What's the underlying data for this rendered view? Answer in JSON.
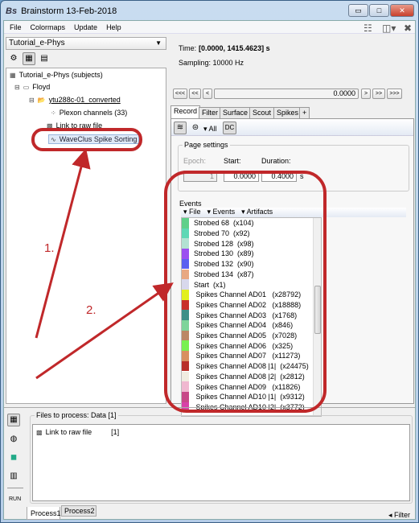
{
  "window": {
    "title": "Brainstorm 13-Feb-2018",
    "min": "▭",
    "max": "□",
    "close": "✕"
  },
  "menu": [
    "File",
    "Colormaps",
    "Update",
    "Help"
  ],
  "toolbar_right": {
    "list_icon": "☷",
    "layout_icon": "◫▾",
    "close_icon": "✖"
  },
  "left": {
    "protocol": "Tutorial_e-Phys",
    "tree": {
      "root": "Tutorial_e-Phys (subjects)",
      "subject": "Floyd",
      "condition": "ytu288c-01_converted",
      "channels": "Plexon channels (33)",
      "link": "Link to raw file",
      "selected": "WaveClus Spike Sorting"
    }
  },
  "right": {
    "time_label": "Time:",
    "time_value": "[0.0000, 1415.4623] s",
    "sampling": "Sampling: 10000 Hz",
    "nav": [
      "<<<",
      "<<",
      "<",
      "0.0000",
      ">",
      ">>",
      ">>>"
    ],
    "tabs": [
      "Record",
      "Filter",
      "Surface",
      "Scout",
      "Spikes",
      "+"
    ],
    "record_toolbar": {
      "all": "▾ All",
      "dc": "DC"
    },
    "page_settings": {
      "title": "Page settings",
      "epoch_label": "Epoch:",
      "start_label": "Start:",
      "duration_label": "Duration:",
      "epoch": "1",
      "start": "0.0000",
      "duration": "0.4000",
      "unit": "s"
    },
    "events": {
      "title": "Events",
      "menus": [
        "▾ File",
        "▾ Events",
        "▾ Artifacts"
      ],
      "items": [
        {
          "label": "Strobed 68  (x104)",
          "color": "#5fd08a"
        },
        {
          "label": "Strobed 70  (x92)",
          "color": "#5fd8b5"
        },
        {
          "label": "Strobed 128  (x98)",
          "color": "#b2e2d2"
        },
        {
          "label": "Strobed 130  (x89)",
          "color": "#9b4ff0"
        },
        {
          "label": "Strobed 132  (x90)",
          "color": "#5a60f0"
        },
        {
          "label": "Strobed 134  (x87)",
          "color": "#e8a882"
        },
        {
          "label": "Start  (x1)",
          "color": "#d8d8ec"
        },
        {
          "label": " Spikes Channel AD01   (x28792)",
          "color": "#e2ef1e"
        },
        {
          "label": " Spikes Channel AD02   (x18888)",
          "color": "#c8302a"
        },
        {
          "label": " Spikes Channel AD03   (x1768)",
          "color": "#3f8f88"
        },
        {
          "label": " Spikes Channel AD04   (x846)",
          "color": "#7ed49a"
        },
        {
          "label": " Spikes Channel AD05   (x7028)",
          "color": "#bb8866"
        },
        {
          "label": " Spikes Channel AD06   (x325)",
          "color": "#78f050"
        },
        {
          "label": " Spikes Channel AD07   (x11273)",
          "color": "#d89060"
        },
        {
          "label": " Spikes Channel AD08 |1|  (x24475)",
          "color": "#b8302a"
        },
        {
          "label": " Spikes Channel AD08 |2|  (x2812)",
          "color": "#f0ece0"
        },
        {
          "label": " Spikes Channel AD09   (x11826)",
          "color": "#f0b8d0"
        },
        {
          "label": " Spikes Channel AD10 |1|  (x9312)",
          "color": "#c84888"
        },
        {
          "label": " Spikes Channel AD10 |2|  (x3772)",
          "color": "#d840a8"
        }
      ]
    }
  },
  "process": {
    "title": "Files to process: Data [1]",
    "item": "Link to raw file",
    "count": "[1]",
    "run": "RUN",
    "tabs": [
      "Process1",
      "Process2"
    ],
    "filter": "◂ Filter"
  },
  "annotations": {
    "label1": "1.",
    "label2": "2.",
    "color": "#c0282a"
  }
}
